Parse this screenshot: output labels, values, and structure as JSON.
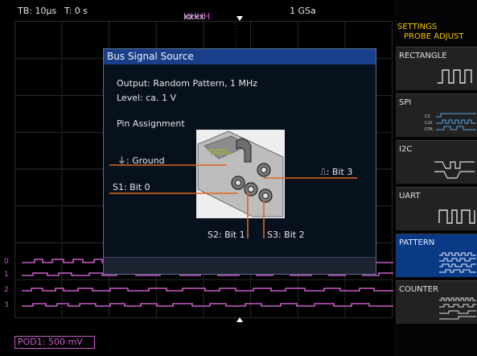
{
  "status_bar": {
    "timebase": "TB: 10µs",
    "time": "T: 0 s",
    "trigger_prefix": "xx",
    "trigger_bits": "HHHH",
    "trigger_suffix": "xxxx",
    "sample_rate": "1 GSa"
  },
  "channels": [
    "0",
    "1",
    "2",
    "3"
  ],
  "dialog": {
    "title": "Bus Signal Source",
    "output": "Output: Random Pattern, 1 MHz",
    "level": "Level: ca. 1 V",
    "pin_heading": "Pin Assignment",
    "pins": {
      "ground": "⏚: Ground",
      "bit0": "S1: Bit 0",
      "bit1": "S2: Bit 1",
      "bit2": "S3: Bit 2",
      "bit3": "⎍: Bit 3"
    }
  },
  "menu": {
    "header_1": "SETTINGS",
    "header_2": "PROBE ADJUST",
    "items": [
      {
        "label": "RECTANGLE",
        "active": false
      },
      {
        "label": "SPI",
        "active": false,
        "sub": [
          "CS",
          "CLK",
          "DTA"
        ]
      },
      {
        "label": "I2C",
        "active": false
      },
      {
        "label": "UART",
        "active": false
      },
      {
        "label": "PATTERN",
        "active": true
      },
      {
        "label": "COUNTER",
        "active": false
      }
    ]
  },
  "bottom": {
    "pod_label": "POD1: 500 mV"
  },
  "colors": {
    "accent_yellow": "#f0c400",
    "trace_magenta": "#c85bc8",
    "active_blue": "#0a3a86",
    "dialog_title_blue": "#1a3f8a",
    "wire_orange": "#e0661f"
  }
}
